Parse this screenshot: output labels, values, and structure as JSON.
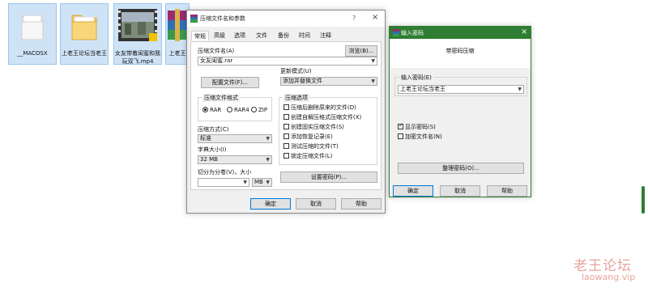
{
  "desktop": {
    "icons": [
      {
        "label": "__MACOSX",
        "kind": "folder"
      },
      {
        "label": "上老王论坛当老王",
        "kind": "folder"
      },
      {
        "label": "女友带着闺蜜和我玩双飞.mp4",
        "kind": "video"
      },
      {
        "label": "上老王",
        "kind": "winrar-archive"
      }
    ]
  },
  "archive_dialog": {
    "title": "压缩文件名和参数",
    "help_glyph": "?",
    "close_glyph": "×",
    "tabs": [
      "常规",
      "高级",
      "选项",
      "文件",
      "备份",
      "时间",
      "注释"
    ],
    "active_tab": "常规",
    "archive_name_label": "压缩文件名(A)",
    "browse_button": "浏览(B)...",
    "archive_name_value": "女友闺蜜.rar",
    "profiles_button": "配置文件(F)...",
    "update_mode_label": "更新模式(U)",
    "update_mode_value": "添加并替换文件",
    "format_group": "压缩文件格式",
    "formats": [
      "RAR",
      "RAR4",
      "ZIP"
    ],
    "selected_format": "RAR",
    "method_label": "压缩方式(C)",
    "method_value": "标准",
    "dict_label": "字典大小(I)",
    "dict_value": "32 MB",
    "split_label": "切分为分卷(V)，大小",
    "split_value": "",
    "split_unit": "MB",
    "options_group": "压缩选项",
    "options": [
      {
        "label": "压缩后删除原来的文件(D)",
        "checked": false
      },
      {
        "label": "创建自解压格式压缩文件(X)",
        "checked": false
      },
      {
        "label": "创建固实压缩文件(S)",
        "checked": false
      },
      {
        "label": "添加恢复记录(E)",
        "checked": false
      },
      {
        "label": "测试压缩的文件(T)",
        "checked": false
      },
      {
        "label": "锁定压缩文件(L)",
        "checked": false
      }
    ],
    "set_password_button": "设置密码(P)...",
    "ok_button": "确定",
    "cancel_button": "取消",
    "help_button": "帮助"
  },
  "password_dialog": {
    "title": "输入密码",
    "subtitle": "带密码压缩",
    "group_label": "输入密码(E)",
    "password_value": "上老王论坛当老王",
    "show_password_label": "显示密码(S)",
    "show_password_checked": true,
    "encrypt_names_label": "加密文件名(N)",
    "encrypt_names_checked": false,
    "organize_button": "整理密码(O)...",
    "ok_button": "确定",
    "cancel_button": "取消",
    "help_button": "帮助",
    "titlebar_color": "#2e7d32"
  },
  "watermark": {
    "line1": "老王论坛",
    "line2": "laowang.vip",
    "color": "#e9a39c"
  }
}
